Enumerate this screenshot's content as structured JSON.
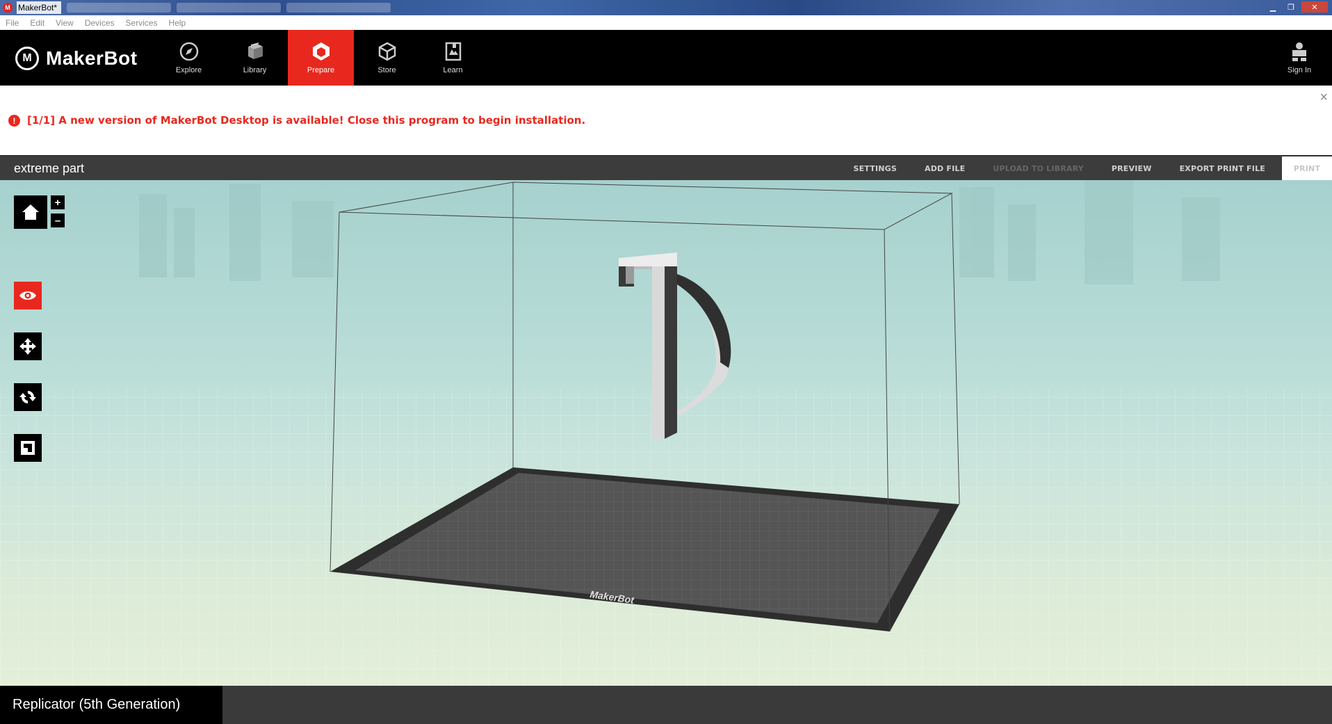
{
  "window": {
    "title": "MakerBot*"
  },
  "menu": [
    "File",
    "Edit",
    "View",
    "Devices",
    "Services",
    "Help"
  ],
  "brand": {
    "name": "MakerBot",
    "mark": "M"
  },
  "nav": {
    "items": [
      {
        "label": "Explore",
        "icon": "compass-icon"
      },
      {
        "label": "Library",
        "icon": "library-icon"
      },
      {
        "label": "Prepare",
        "icon": "prepare-icon",
        "active": true
      },
      {
        "label": "Store",
        "icon": "store-box-icon"
      },
      {
        "label": "Learn",
        "icon": "learn-book-icon"
      }
    ],
    "signin": "Sign In"
  },
  "notice": {
    "text": "[1/1] A new version of MakerBot Desktop is available! Close this program to begin installation.",
    "icon": "alert-icon",
    "close": "×"
  },
  "project": {
    "name": "extreme part",
    "actions": {
      "settings": "SETTINGS",
      "add_file": "ADD FILE",
      "upload": "UPLOAD TO LIBRARY",
      "preview": "PREVIEW",
      "export": "EXPORT PRINT FILE",
      "print": "PRINT"
    }
  },
  "viewport": {
    "zoom_in": "+",
    "zoom_out": "–",
    "plate_label": "MakerBot",
    "colors": {
      "accent": "#e8281e",
      "plate": "#555555",
      "plate_border": "#2e2e2e"
    }
  },
  "footer": {
    "printer": "Replicator (5th Generation)"
  }
}
